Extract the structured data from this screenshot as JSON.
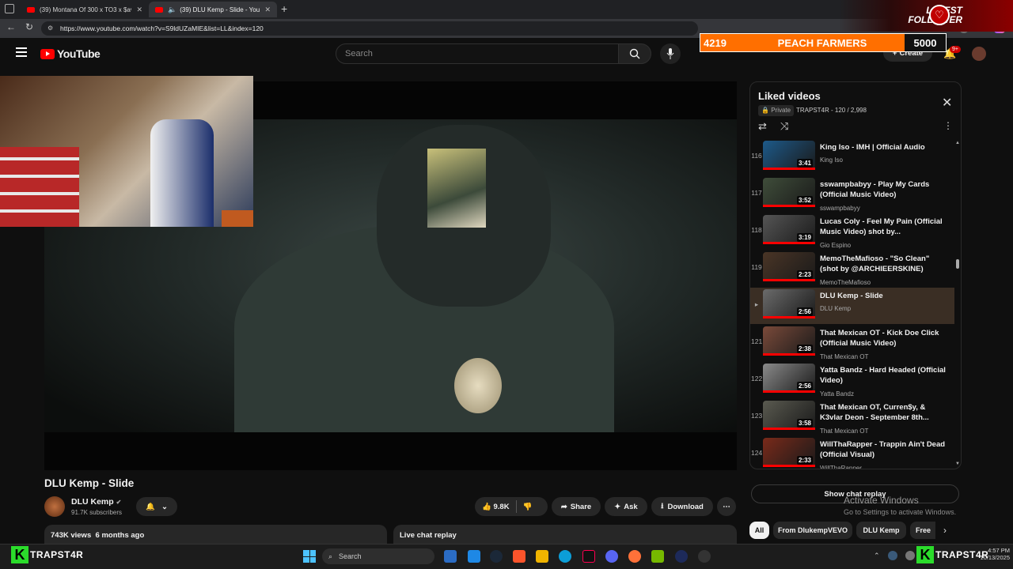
{
  "browser": {
    "tabs": [
      {
        "label": "(39) Montana Of 300 x TO3 x $av"
      },
      {
        "label": "(39) DLU Kemp - Slide - YouT"
      }
    ],
    "url": "https://www.youtube.com/watch?v=S9ldUZaMIE&list=LL&index=120"
  },
  "youtube": {
    "logo_text": "YouTube",
    "search_placeholder": "Search",
    "create_label": "Create",
    "notif_count": "9+"
  },
  "overlay": {
    "latest_line1": "LATEST",
    "latest_line2": "FOLLOWER",
    "goal_current": "4219",
    "goal_name": "PEACH FARMERS",
    "goal_target": "5000",
    "goal_fraction": 0.8438,
    "watermark_name": "TRAPST4R",
    "watermark_letter": "K"
  },
  "playlist": {
    "title": "Liked videos",
    "privacy": "Private",
    "meta": "TRAPST4R - 120 / 2,998",
    "items": [
      {
        "idx": "116",
        "title": "King Iso - IMH | Official Audio",
        "channel": "King Iso",
        "duration": "3:41",
        "color": "#1d5a8a"
      },
      {
        "idx": "117",
        "title": "sswampbabyy - Play My Cards (Official Music Video)",
        "channel": "sswampbabyy",
        "duration": "3:52",
        "color": "#3f4d3a"
      },
      {
        "idx": "118",
        "title": "Lucas Coly - Feel My Pain (Official Music Video) shot by...",
        "channel": "Gio Espino",
        "duration": "3:19",
        "color": "#555555"
      },
      {
        "idx": "119",
        "title": "MemoTheMafioso - \"So Clean\" (shot by @ARCHIEERSKINE)",
        "channel": "MemoTheMafioso",
        "duration": "2:23",
        "color": "#4a3526"
      },
      {
        "idx": "",
        "title": "DLU Kemp - Slide",
        "channel": "DLU Kemp",
        "duration": "2:56",
        "color": "#6b6b6b"
      },
      {
        "idx": "121",
        "title": "That Mexican OT - Kick Doe Click (Official Music Video)",
        "channel": "That Mexican OT",
        "duration": "2:38",
        "color": "#7a4a3a"
      },
      {
        "idx": "122",
        "title": "Yatta Bandz - Hard Headed (Official Video)",
        "channel": "Yatta Bandz",
        "duration": "2:56",
        "color": "#8a8a8a"
      },
      {
        "idx": "123",
        "title": "That Mexican OT, Curren$y, & K3vlar Deon - September 8th...",
        "channel": "That Mexican OT",
        "duration": "3:58",
        "color": "#5a5a50"
      },
      {
        "idx": "124",
        "title": "WillThaRapper - Trappin Ain't Dead (Official Visual)",
        "channel": "WillThaRapper",
        "duration": "2:33",
        "color": "#7a2a1a"
      }
    ]
  },
  "video": {
    "title": "DLU Kemp - Slide",
    "channel": "DLU Kemp",
    "subscribers": "91.7K subscribers",
    "likes": "9.8K",
    "share": "Share",
    "ask": "Ask",
    "download": "Download",
    "views": "743K views",
    "age": "6 months ago",
    "live_chat": "Live chat replay",
    "show_chat": "Show chat replay"
  },
  "chips": [
    "All",
    "From DlukempVEVO",
    "DLU Kemp",
    "Free"
  ],
  "windows": {
    "activate_title": "Activate Windows",
    "activate_sub": "Go to Settings to activate Windows.",
    "taskbar_search": "Search",
    "time": "4:57 PM",
    "date": "10/13/2025"
  }
}
